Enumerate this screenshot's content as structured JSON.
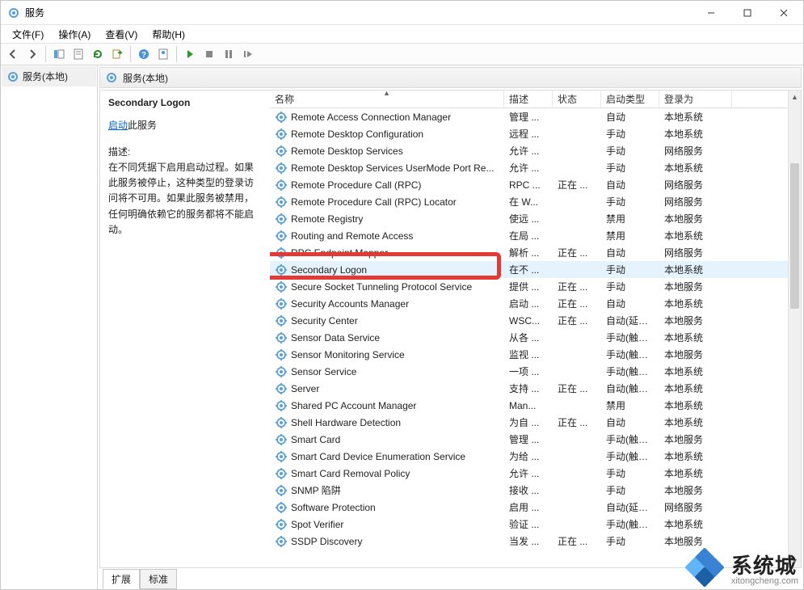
{
  "window_title": "服务",
  "menus": {
    "file": "文件(F)",
    "action": "操作(A)",
    "view": "查看(V)",
    "help": "帮助(H)"
  },
  "left_tree_item": "服务(本地)",
  "right_header": "服务(本地)",
  "tabs": {
    "extended": "扩展",
    "standard": "标准"
  },
  "detail": {
    "selected_service": "Secondary Logon",
    "start_link": "启动",
    "start_suffix": "此服务",
    "desc_label": "描述:",
    "desc_text": "在不同凭据下启用启动过程。如果此服务被停止，这种类型的登录访问将不可用。如果此服务被禁用，任何明确依赖它的服务都将不能启动。"
  },
  "columns": {
    "name": "名称",
    "desc": "描述",
    "state": "状态",
    "start": "启动类型",
    "logon": "登录为"
  },
  "services": [
    {
      "name": "Remote Access Connection Manager",
      "desc": "管理 ...",
      "state": "",
      "start": "自动",
      "logon": "本地系统"
    },
    {
      "name": "Remote Desktop Configuration",
      "desc": "远程 ...",
      "state": "",
      "start": "手动",
      "logon": "本地系统"
    },
    {
      "name": "Remote Desktop Services",
      "desc": "允许 ...",
      "state": "",
      "start": "手动",
      "logon": "网络服务"
    },
    {
      "name": "Remote Desktop Services UserMode Port Re...",
      "desc": "允许 ...",
      "state": "",
      "start": "手动",
      "logon": "本地系统"
    },
    {
      "name": "Remote Procedure Call (RPC)",
      "desc": "RPC ...",
      "state": "正在 ...",
      "start": "自动",
      "logon": "网络服务"
    },
    {
      "name": "Remote Procedure Call (RPC) Locator",
      "desc": "在 W...",
      "state": "",
      "start": "手动",
      "logon": "网络服务"
    },
    {
      "name": "Remote Registry",
      "desc": "使远 ...",
      "state": "",
      "start": "禁用",
      "logon": "本地服务"
    },
    {
      "name": "Routing and Remote Access",
      "desc": "在局 ...",
      "state": "",
      "start": "禁用",
      "logon": "本地系统"
    },
    {
      "name": "RPC Endpoint Mapper",
      "desc": "解析 ...",
      "state": "正在 ...",
      "start": "自动",
      "logon": "网络服务"
    },
    {
      "name": "Secondary Logon",
      "desc": "在不 ...",
      "state": "",
      "start": "手动",
      "logon": "本地系统",
      "selected": true
    },
    {
      "name": "Secure Socket Tunneling Protocol Service",
      "desc": "提供 ...",
      "state": "正在 ...",
      "start": "手动",
      "logon": "本地服务"
    },
    {
      "name": "Security Accounts Manager",
      "desc": "启动 ...",
      "state": "正在 ...",
      "start": "自动",
      "logon": "本地系统"
    },
    {
      "name": "Security Center",
      "desc": "WSC...",
      "state": "正在 ...",
      "start": "自动(延迟 ...",
      "logon": "本地服务"
    },
    {
      "name": "Sensor Data Service",
      "desc": "从各 ...",
      "state": "",
      "start": "手动(触发 ...",
      "logon": "本地系统"
    },
    {
      "name": "Sensor Monitoring Service",
      "desc": "监视 ...",
      "state": "",
      "start": "手动(触发 ...",
      "logon": "本地服务"
    },
    {
      "name": "Sensor Service",
      "desc": "一项 ...",
      "state": "",
      "start": "手动(触发 ...",
      "logon": "本地系统"
    },
    {
      "name": "Server",
      "desc": "支持 ...",
      "state": "正在 ...",
      "start": "自动(触发 ...",
      "logon": "本地系统"
    },
    {
      "name": "Shared PC Account Manager",
      "desc": "Man...",
      "state": "",
      "start": "禁用",
      "logon": "本地系统"
    },
    {
      "name": "Shell Hardware Detection",
      "desc": "为自 ...",
      "state": "正在 ...",
      "start": "自动",
      "logon": "本地系统"
    },
    {
      "name": "Smart Card",
      "desc": "管理 ...",
      "state": "",
      "start": "手动(触发 ...",
      "logon": "本地服务"
    },
    {
      "name": "Smart Card Device Enumeration Service",
      "desc": "为给 ...",
      "state": "",
      "start": "手动(触发 ...",
      "logon": "本地系统"
    },
    {
      "name": "Smart Card Removal Policy",
      "desc": "允许 ...",
      "state": "",
      "start": "手动",
      "logon": "本地系统"
    },
    {
      "name": "SNMP 陷阱",
      "desc": "接收 ...",
      "state": "",
      "start": "手动",
      "logon": "本地服务"
    },
    {
      "name": "Software Protection",
      "desc": "启用 ...",
      "state": "",
      "start": "自动(延迟 ...",
      "logon": "网络服务"
    },
    {
      "name": "Spot Verifier",
      "desc": "验证 ...",
      "state": "",
      "start": "手动(触发 ...",
      "logon": "本地系统"
    },
    {
      "name": "SSDP Discovery",
      "desc": "当发 ...",
      "state": "正在 ...",
      "start": "手动",
      "logon": "本地服务"
    }
  ],
  "watermark": {
    "text": "系统城",
    "url": "xitongcheng.com"
  }
}
